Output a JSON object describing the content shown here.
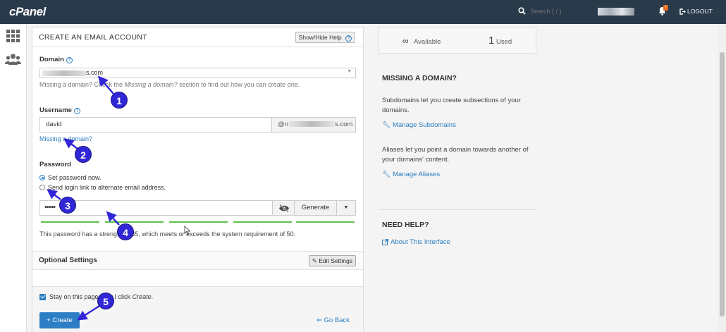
{
  "topbar": {
    "logo": "cPanel",
    "search_placeholder": "Search ( / )",
    "logout_label": "LOGOUT",
    "bell_badge": "!"
  },
  "form": {
    "title": "CREATE AN EMAIL ACCOUNT",
    "help_toggle": "Show/Hide Help",
    "domain_label": "Domain",
    "domain_value": "s.com",
    "domain_help_prefix": "Missing a domain? Check the ",
    "domain_help_italic": "Missing a domain?",
    "domain_help_suffix": " section to find out how you can create one.",
    "username_label": "Username",
    "username_value": "david",
    "username_addon_prefix": "@n",
    "username_addon_suffix": "s.com",
    "username_link": "Missing a domain?",
    "password_label": "Password",
    "radio_set_now": "Set password now.",
    "radio_send_link": "Send login link to alternate email address.",
    "password_mask": "••••••",
    "generate_label": "Generate",
    "strength_text": "This password has a strength of 85, which meets or exceeds the system requirement of 50.",
    "optional_title": "Optional Settings",
    "edit_settings": "Edit Settings",
    "stay_prefix": "Stay on this page after I click ",
    "stay_italic": "Create",
    "stay_suffix": ".",
    "create_label": "+ Create",
    "go_back": "Go Back"
  },
  "stats": {
    "available_value": "∞",
    "available_label": "Available",
    "used_value": "1",
    "used_label": "Used"
  },
  "sidebar": {
    "missing_title": "MISSING A DOMAIN?",
    "missing_text": "Subdomains let you create subsections of your domains.",
    "manage_subdomains": "Manage Subdomains",
    "aliases_text": "Aliases let you point a domain towards another of your domains' content.",
    "manage_aliases": "Manage Aliases",
    "help_title": "NEED HELP?",
    "about_link": "About This Interface"
  },
  "annotations": [
    "1",
    "2",
    "3",
    "4",
    "5"
  ],
  "colors": {
    "topbar": "#293a4a",
    "link": "#2a7ec2",
    "primary_button": "#2c7ec5",
    "strength": "#5ec14b",
    "marker": "#3227d6"
  }
}
